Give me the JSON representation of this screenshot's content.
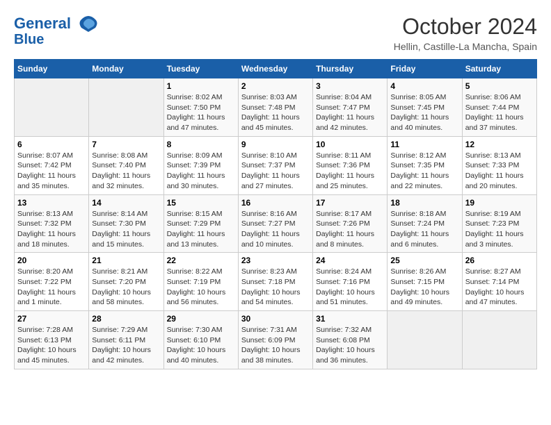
{
  "header": {
    "logo_line1": "General",
    "logo_line2": "Blue",
    "month": "October 2024",
    "location": "Hellin, Castille-La Mancha, Spain"
  },
  "days_of_week": [
    "Sunday",
    "Monday",
    "Tuesday",
    "Wednesday",
    "Thursday",
    "Friday",
    "Saturday"
  ],
  "weeks": [
    [
      {
        "day": "",
        "empty": true
      },
      {
        "day": "",
        "empty": true
      },
      {
        "day": "1",
        "sunrise": "8:02 AM",
        "sunset": "7:50 PM",
        "daylight": "11 hours and 47 minutes."
      },
      {
        "day": "2",
        "sunrise": "8:03 AM",
        "sunset": "7:48 PM",
        "daylight": "11 hours and 45 minutes."
      },
      {
        "day": "3",
        "sunrise": "8:04 AM",
        "sunset": "7:47 PM",
        "daylight": "11 hours and 42 minutes."
      },
      {
        "day": "4",
        "sunrise": "8:05 AM",
        "sunset": "7:45 PM",
        "daylight": "11 hours and 40 minutes."
      },
      {
        "day": "5",
        "sunrise": "8:06 AM",
        "sunset": "7:44 PM",
        "daylight": "11 hours and 37 minutes."
      }
    ],
    [
      {
        "day": "6",
        "sunrise": "8:07 AM",
        "sunset": "7:42 PM",
        "daylight": "11 hours and 35 minutes."
      },
      {
        "day": "7",
        "sunrise": "8:08 AM",
        "sunset": "7:40 PM",
        "daylight": "11 hours and 32 minutes."
      },
      {
        "day": "8",
        "sunrise": "8:09 AM",
        "sunset": "7:39 PM",
        "daylight": "11 hours and 30 minutes."
      },
      {
        "day": "9",
        "sunrise": "8:10 AM",
        "sunset": "7:37 PM",
        "daylight": "11 hours and 27 minutes."
      },
      {
        "day": "10",
        "sunrise": "8:11 AM",
        "sunset": "7:36 PM",
        "daylight": "11 hours and 25 minutes."
      },
      {
        "day": "11",
        "sunrise": "8:12 AM",
        "sunset": "7:35 PM",
        "daylight": "11 hours and 22 minutes."
      },
      {
        "day": "12",
        "sunrise": "8:13 AM",
        "sunset": "7:33 PM",
        "daylight": "11 hours and 20 minutes."
      }
    ],
    [
      {
        "day": "13",
        "sunrise": "8:13 AM",
        "sunset": "7:32 PM",
        "daylight": "11 hours and 18 minutes."
      },
      {
        "day": "14",
        "sunrise": "8:14 AM",
        "sunset": "7:30 PM",
        "daylight": "11 hours and 15 minutes."
      },
      {
        "day": "15",
        "sunrise": "8:15 AM",
        "sunset": "7:29 PM",
        "daylight": "11 hours and 13 minutes."
      },
      {
        "day": "16",
        "sunrise": "8:16 AM",
        "sunset": "7:27 PM",
        "daylight": "11 hours and 10 minutes."
      },
      {
        "day": "17",
        "sunrise": "8:17 AM",
        "sunset": "7:26 PM",
        "daylight": "11 hours and 8 minutes."
      },
      {
        "day": "18",
        "sunrise": "8:18 AM",
        "sunset": "7:24 PM",
        "daylight": "11 hours and 6 minutes."
      },
      {
        "day": "19",
        "sunrise": "8:19 AM",
        "sunset": "7:23 PM",
        "daylight": "11 hours and 3 minutes."
      }
    ],
    [
      {
        "day": "20",
        "sunrise": "8:20 AM",
        "sunset": "7:22 PM",
        "daylight": "11 hours and 1 minute."
      },
      {
        "day": "21",
        "sunrise": "8:21 AM",
        "sunset": "7:20 PM",
        "daylight": "10 hours and 58 minutes."
      },
      {
        "day": "22",
        "sunrise": "8:22 AM",
        "sunset": "7:19 PM",
        "daylight": "10 hours and 56 minutes."
      },
      {
        "day": "23",
        "sunrise": "8:23 AM",
        "sunset": "7:18 PM",
        "daylight": "10 hours and 54 minutes."
      },
      {
        "day": "24",
        "sunrise": "8:24 AM",
        "sunset": "7:16 PM",
        "daylight": "10 hours and 51 minutes."
      },
      {
        "day": "25",
        "sunrise": "8:26 AM",
        "sunset": "7:15 PM",
        "daylight": "10 hours and 49 minutes."
      },
      {
        "day": "26",
        "sunrise": "8:27 AM",
        "sunset": "7:14 PM",
        "daylight": "10 hours and 47 minutes."
      }
    ],
    [
      {
        "day": "27",
        "sunrise": "7:28 AM",
        "sunset": "6:13 PM",
        "daylight": "10 hours and 45 minutes."
      },
      {
        "day": "28",
        "sunrise": "7:29 AM",
        "sunset": "6:11 PM",
        "daylight": "10 hours and 42 minutes."
      },
      {
        "day": "29",
        "sunrise": "7:30 AM",
        "sunset": "6:10 PM",
        "daylight": "10 hours and 40 minutes."
      },
      {
        "day": "30",
        "sunrise": "7:31 AM",
        "sunset": "6:09 PM",
        "daylight": "10 hours and 38 minutes."
      },
      {
        "day": "31",
        "sunrise": "7:32 AM",
        "sunset": "6:08 PM",
        "daylight": "10 hours and 36 minutes."
      },
      {
        "day": "",
        "empty": true
      },
      {
        "day": "",
        "empty": true
      }
    ]
  ]
}
